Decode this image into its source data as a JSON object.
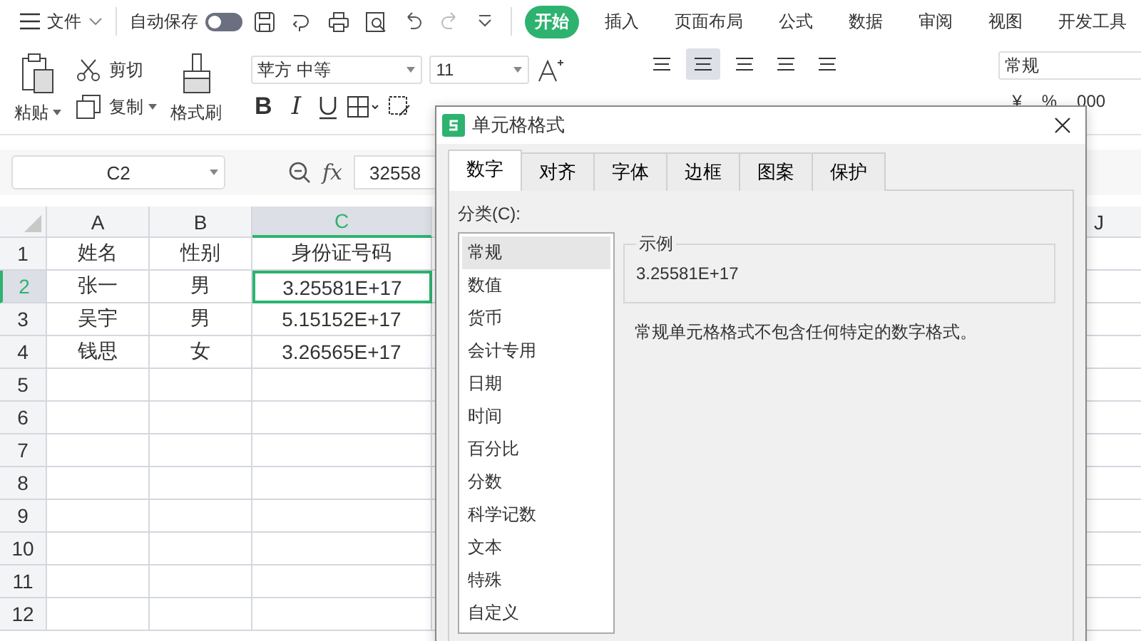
{
  "menu_bar": {
    "menu_label": "文件",
    "autosave": {
      "label": "自动保存",
      "on": false
    },
    "tabs": [
      {
        "label": "开始",
        "selected": true
      },
      {
        "label": "插入",
        "selected": false
      },
      {
        "label": "页面布局",
        "selected": false
      },
      {
        "label": "公式",
        "selected": false
      },
      {
        "label": "数据",
        "selected": false
      },
      {
        "label": "审阅",
        "selected": false
      },
      {
        "label": "视图",
        "selected": false
      },
      {
        "label": "开发工具",
        "selected": false
      }
    ]
  },
  "ribbon": {
    "paste": "粘贴",
    "cut": "剪切",
    "copy": "复制",
    "format_painter": "格式刷",
    "font_name": "苹方 中等",
    "font_size": "11",
    "bold": "B",
    "italic": "I",
    "alignment": [
      {
        "selected": false
      },
      {
        "selected": true
      },
      {
        "selected": false
      },
      {
        "selected": false
      },
      {
        "selected": false
      }
    ],
    "number_format": "常规",
    "number_symbols": [
      "¥",
      "%",
      "000"
    ]
  },
  "formula_bar": {
    "cell_ref": "C2",
    "fx": "fx",
    "value": "32558"
  },
  "sheet": {
    "columns": [
      {
        "label": "A",
        "selected": false,
        "gap_before": false
      },
      {
        "label": "B",
        "selected": false,
        "gap_before": false
      },
      {
        "label": "C",
        "selected": true,
        "gap_before": false
      },
      {
        "label": "J",
        "selected": false,
        "gap_before": true
      }
    ],
    "rows": [
      {
        "number": "1",
        "selected": false,
        "cells": [
          {
            "text": "姓名",
            "active": false
          },
          {
            "text": "性别",
            "active": false
          },
          {
            "text": "身份证号码",
            "active": false
          }
        ]
      },
      {
        "number": "2",
        "selected": true,
        "cells": [
          {
            "text": "张一",
            "active": false
          },
          {
            "text": "男",
            "active": false
          },
          {
            "text": "3.25581E+17",
            "active": true
          }
        ]
      },
      {
        "number": "3",
        "selected": false,
        "cells": [
          {
            "text": "吴宇",
            "active": false
          },
          {
            "text": "男",
            "active": false
          },
          {
            "text": "5.15152E+17",
            "active": false
          }
        ]
      },
      {
        "number": "4",
        "selected": false,
        "cells": [
          {
            "text": "钱思",
            "active": false
          },
          {
            "text": "女",
            "active": false
          },
          {
            "text": "3.26565E+17",
            "active": false
          }
        ]
      },
      {
        "number": "5",
        "selected": false
      },
      {
        "number": "6",
        "selected": false
      },
      {
        "number": "7",
        "selected": false
      },
      {
        "number": "8",
        "selected": false
      },
      {
        "number": "9",
        "selected": false
      },
      {
        "number": "10",
        "selected": false
      },
      {
        "number": "11",
        "selected": false
      },
      {
        "number": "12",
        "selected": false
      }
    ]
  },
  "dialog": {
    "title": "单元格格式",
    "tabs": [
      {
        "label": "数字",
        "selected": true
      },
      {
        "label": "对齐",
        "selected": false
      },
      {
        "label": "字体",
        "selected": false
      },
      {
        "label": "边框",
        "selected": false
      },
      {
        "label": "图案",
        "selected": false
      },
      {
        "label": "保护",
        "selected": false
      }
    ],
    "category_label": "分类(C):",
    "categories": [
      {
        "label": "常规",
        "selected": true
      },
      {
        "label": "数值",
        "selected": false
      },
      {
        "label": "货币",
        "selected": false
      },
      {
        "label": "会计专用",
        "selected": false
      },
      {
        "label": "日期",
        "selected": false
      },
      {
        "label": "时间",
        "selected": false
      },
      {
        "label": "百分比",
        "selected": false
      },
      {
        "label": "分数",
        "selected": false
      },
      {
        "label": "科学记数",
        "selected": false
      },
      {
        "label": "文本",
        "selected": false
      },
      {
        "label": "特殊",
        "selected": false
      },
      {
        "label": "自定义",
        "selected": false
      }
    ],
    "sample_legend": "示例",
    "sample_value": "3.25581E+17",
    "description": "常规单元格格式不包含任何特定的数字格式。"
  }
}
